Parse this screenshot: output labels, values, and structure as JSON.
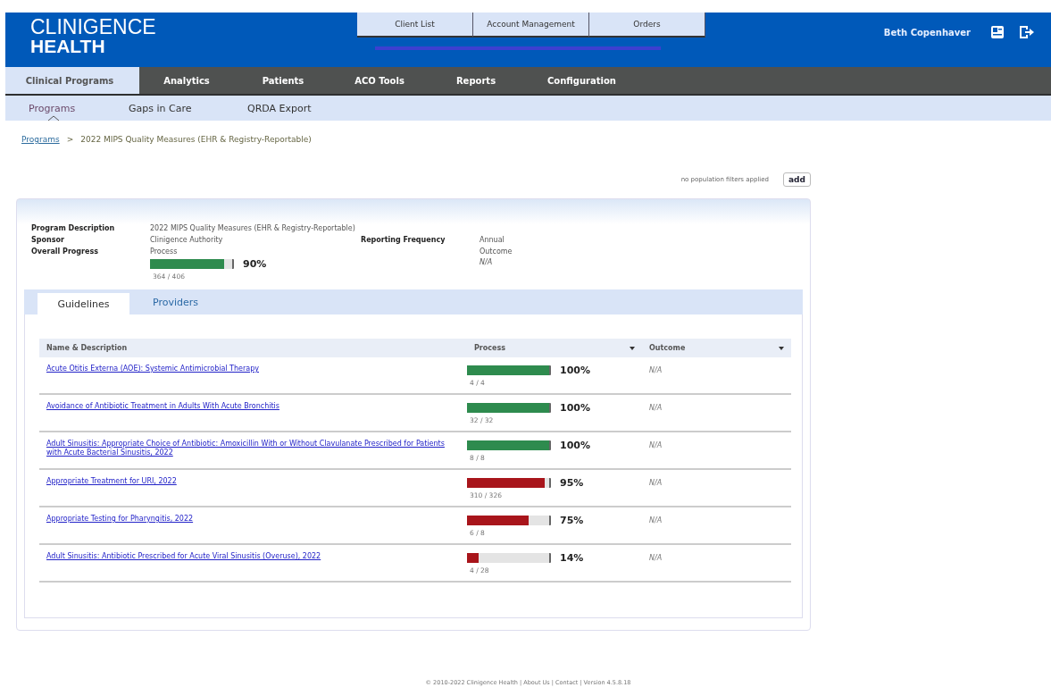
{
  "logo": {
    "line1": "CLINIGENCE",
    "line2": "HEALTH"
  },
  "top_tabs": [
    {
      "label": "Client List",
      "selected": false
    },
    {
      "label": "Account Management",
      "selected": false
    },
    {
      "label": "Orders",
      "selected": false
    }
  ],
  "user": {
    "name": "Beth Copenhaver"
  },
  "main_nav": [
    {
      "label": "Clinical Programs",
      "selected": true
    },
    {
      "label": "Analytics",
      "selected": false
    },
    {
      "label": "Patients",
      "selected": false
    },
    {
      "label": "ACO Tools",
      "selected": false
    },
    {
      "label": "Reports",
      "selected": false
    },
    {
      "label": "Configuration",
      "selected": false
    }
  ],
  "sub_nav": [
    {
      "label": "Programs",
      "selected": true
    },
    {
      "label": "Gaps in Care",
      "selected": false
    },
    {
      "label": "QRDA Export",
      "selected": false
    }
  ],
  "breadcrumb": {
    "link": "Programs",
    "separator": ">",
    "current": "2022 MIPS Quality Measures (EHR & Registry-Reportable)"
  },
  "filters": {
    "text": "no population filters applied",
    "button": "add"
  },
  "program": {
    "description_label": "Program Description",
    "description": "2022 MIPS Quality Measures (EHR & Registry-Reportable)",
    "sponsor_label": "Sponsor",
    "sponsor": "Clinigence Authority",
    "frequency_label": "Reporting Frequency",
    "frequency": "Annual",
    "progress_label": "Overall Progress",
    "process_label": "Process",
    "process": {
      "level": 0.9,
      "color": "#2e8b4e",
      "percent": "90%",
      "count": "364 / 406"
    },
    "outcome_label": "Outcome",
    "outcome": "N/A"
  },
  "tabs": [
    {
      "label": "Guidelines",
      "selected": true
    },
    {
      "label": "Providers",
      "selected": false
    }
  ],
  "table": {
    "columns": [
      "Name & Description",
      "Process",
      "Outcome"
    ],
    "rows": [
      {
        "name": "Acute Otitis Externa (AOE): Systemic Antimicrobial Therapy",
        "level": 1,
        "color": "#2e8b4e",
        "percent": "100%",
        "count": "4 / 4",
        "outcome": "N/A"
      },
      {
        "name": "Avoidance of Antibiotic Treatment in Adults With Acute Bronchitis",
        "level": 1,
        "color": "#2e8b4e",
        "percent": "100%",
        "count": "32 / 32",
        "outcome": "N/A"
      },
      {
        "name": "Adult Sinusitis: Appropriate Choice of Antibiotic: Amoxicillin With or Without Clavulanate Prescribed for Patients with Acute Bacterial Sinusitis, 2022",
        "level": 1,
        "color": "#2e8b4e",
        "percent": "100%",
        "count": "8 / 8",
        "outcome": "N/A"
      },
      {
        "name": "Appropriate Treatment for URI, 2022",
        "level": 0.95,
        "color": "#a8151b",
        "percent": "95%",
        "count": "310 / 326",
        "outcome": "N/A"
      },
      {
        "name": "Appropriate Testing for Pharyngitis, 2022",
        "level": 0.75,
        "color": "#a8151b",
        "percent": "75%",
        "count": "6 / 8",
        "outcome": "N/A"
      },
      {
        "name": "Adult Sinusitis: Antibiotic Prescribed for Acute Viral Sinusitis (Overuse), 2022",
        "level": 0.14,
        "color": "#a8151b",
        "percent": "14%",
        "count": "4 / 28",
        "outcome": "N/A"
      }
    ]
  },
  "footer": {
    "text": "© 2010-2022 Clinigence Health | About Us | Contact | Version 4.5.8.18"
  }
}
